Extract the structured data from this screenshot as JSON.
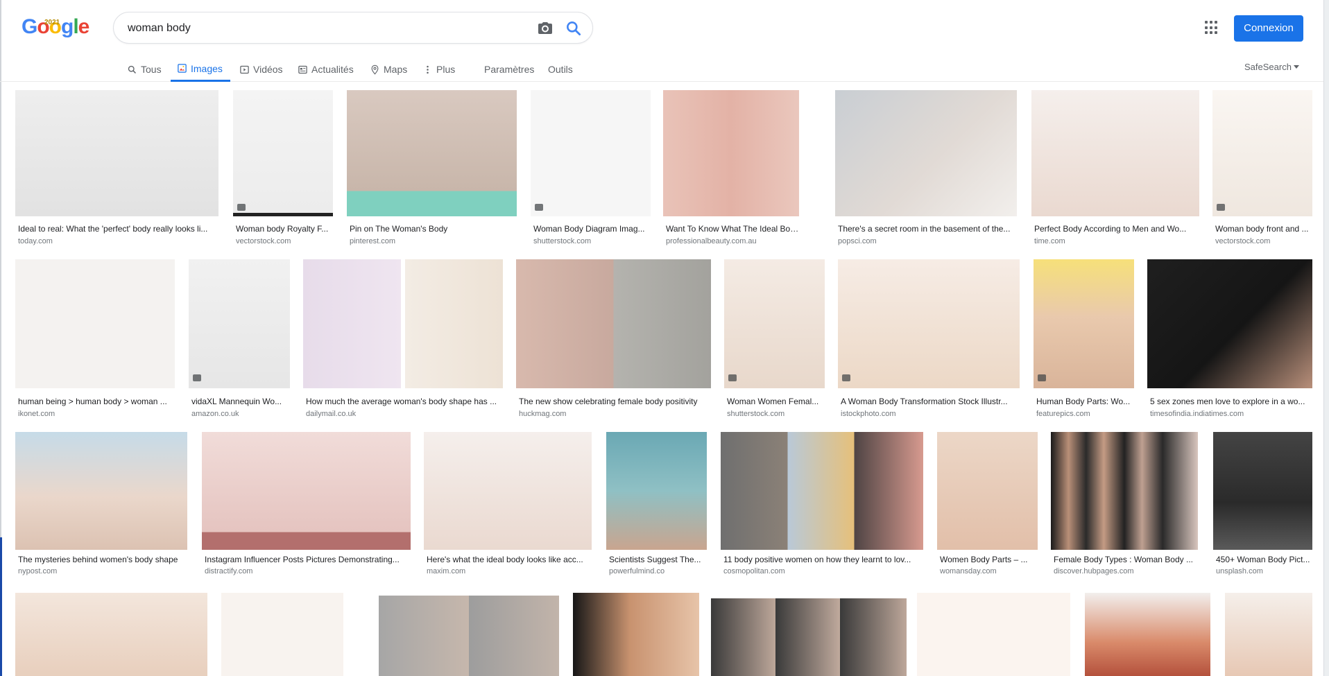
{
  "logo": {
    "letters": [
      "G",
      "o",
      "o",
      "g",
      "l",
      "e"
    ],
    "year": "2021"
  },
  "search": {
    "query": "woman body",
    "camera_icon": "camera-icon",
    "search_icon": "search-icon"
  },
  "header": {
    "apps_icon": "apps-grid-icon",
    "signin_label": "Connexion"
  },
  "tabs": [
    {
      "label": "Tous",
      "icon": "search-icon"
    },
    {
      "label": "Images",
      "icon": "image-icon",
      "active": true
    },
    {
      "label": "Vidéos",
      "icon": "video-icon"
    },
    {
      "label": "Actualités",
      "icon": "news-icon"
    },
    {
      "label": "Maps",
      "icon": "map-pin-icon"
    },
    {
      "label": "Plus",
      "icon": "more-vert-icon"
    },
    {
      "label": "Paramètres"
    },
    {
      "label": "Outils"
    }
  ],
  "safesearch": {
    "label": "SafeSearch",
    "icon": "dropdown-arrow-icon"
  },
  "colors": {
    "accent": "#1a73e8",
    "caption": "#202124",
    "source": "#70757a"
  },
  "results": {
    "row1": [
      {
        "title": "Ideal to real: What the 'perfect' body really looks li...",
        "source": "today.com"
      },
      {
        "title": "Woman body Royalty F...",
        "source": "vectorstock.com"
      },
      {
        "title": "Pin on The Woman's Body",
        "source": "pinterest.com"
      },
      {
        "title": "Woman Body Diagram Imag...",
        "source": "shutterstock.com"
      },
      {
        "title": "Want To Know What The Ideal Body Sh...",
        "source": "professionalbeauty.com.au"
      },
      {
        "title": "There's a secret room in the basement of the...",
        "source": "popsci.com"
      },
      {
        "title": "Perfect Body According to Men and Wo...",
        "source": "time.com"
      },
      {
        "title": "Woman body front and ...",
        "source": "vectorstock.com"
      }
    ],
    "row2": [
      {
        "title": "human being > human body > woman ...",
        "source": "ikonet.com"
      },
      {
        "title": "vidaXL Mannequin Wo...",
        "source": "amazon.co.uk"
      },
      {
        "title": "How much the average woman's body shape has ...",
        "source": "dailymail.co.uk"
      },
      {
        "title": "The new show celebrating female body positivity",
        "source": "huckmag.com"
      },
      {
        "title": "Woman Women Femal...",
        "source": "shutterstock.com"
      },
      {
        "title": "A Woman Body Transformation Stock Illustr...",
        "source": "istockphoto.com"
      },
      {
        "title": "Human Body Parts: Wo...",
        "source": "featurepics.com"
      },
      {
        "title": "5 sex zones men love to explore in a wo...",
        "source": "timesofindia.indiatimes.com"
      }
    ],
    "row3": [
      {
        "title": "The mysteries behind women's body shape",
        "source": "nypost.com"
      },
      {
        "title": "Instagram Influencer Posts Pictures Demonstrating...",
        "source": "distractify.com"
      },
      {
        "title": "Here's what the ideal body looks like acc...",
        "source": "maxim.com"
      },
      {
        "title": "Scientists Suggest The...",
        "source": "powerfulmind.co"
      },
      {
        "title": "11 body positive women on how they learnt to lov...",
        "source": "cosmopolitan.com"
      },
      {
        "title": "Women Body Parts – ...",
        "source": "womansday.com"
      },
      {
        "title": "Female Body Types : Woman Body ...",
        "source": "discover.hubpages.com"
      },
      {
        "title": "450+ Woman Body Pict...",
        "source": "unsplash.com"
      }
    ],
    "row4": [
      {
        "title": "",
        "source": ""
      },
      {
        "title": "",
        "source": ""
      },
      {
        "title": "",
        "source": ""
      },
      {
        "title": "",
        "source": ""
      },
      {
        "title": "",
        "source": ""
      },
      {
        "title": "",
        "source": ""
      },
      {
        "title": "",
        "source": ""
      },
      {
        "title": "",
        "source": ""
      }
    ]
  }
}
